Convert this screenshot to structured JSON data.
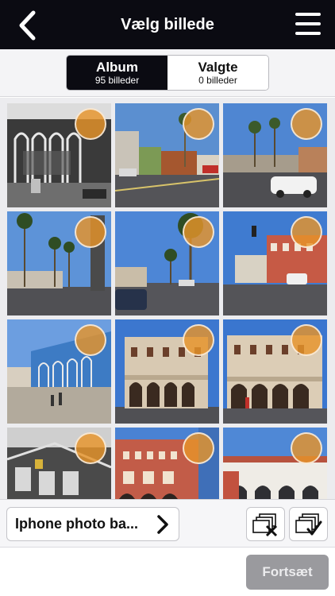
{
  "header": {
    "title": "Vælg billede",
    "back_icon": "chevron-left-icon",
    "menu_icon": "hamburger-menu-icon"
  },
  "tabs": [
    {
      "label": "Album",
      "sublabel": "95 billeder",
      "active": true
    },
    {
      "label": "Valgte",
      "sublabel": "0 billeder",
      "active": false
    }
  ],
  "photos": [
    {
      "scene": "Black and white building with murals",
      "selected": false
    },
    {
      "scene": "Street with palm trees and parked cars",
      "selected": false
    },
    {
      "scene": "Street with palm trees and white car",
      "selected": false
    },
    {
      "scene": "Palm trees along street",
      "selected": false
    },
    {
      "scene": "Palm trees under blue sky",
      "selected": false
    },
    {
      "scene": "Intersection with red brick building",
      "selected": false
    },
    {
      "scene": "Blue arcade building and boardwalk",
      "selected": false
    },
    {
      "scene": "Historic arcaded building",
      "selected": false
    },
    {
      "scene": "Historic arcaded building front",
      "selected": false
    },
    {
      "scene": "Black and white street scene",
      "selected": false
    },
    {
      "scene": "Red brick building with arches",
      "selected": false
    },
    {
      "scene": "White arcaded building",
      "selected": false
    }
  ],
  "bottom_bar": {
    "album_label": "Iphone photo ba...",
    "album_chevron_icon": "chevron-right-icon",
    "deselect_all_icon": "deselect-all-icon",
    "select_all_icon": "select-all-icon"
  },
  "footer": {
    "continue_label": "Fortsæt"
  },
  "colors": {
    "header_bg": "#0b0b12",
    "selection_circle": "#e7942a",
    "continue_disabled": "#9a9a9e"
  }
}
